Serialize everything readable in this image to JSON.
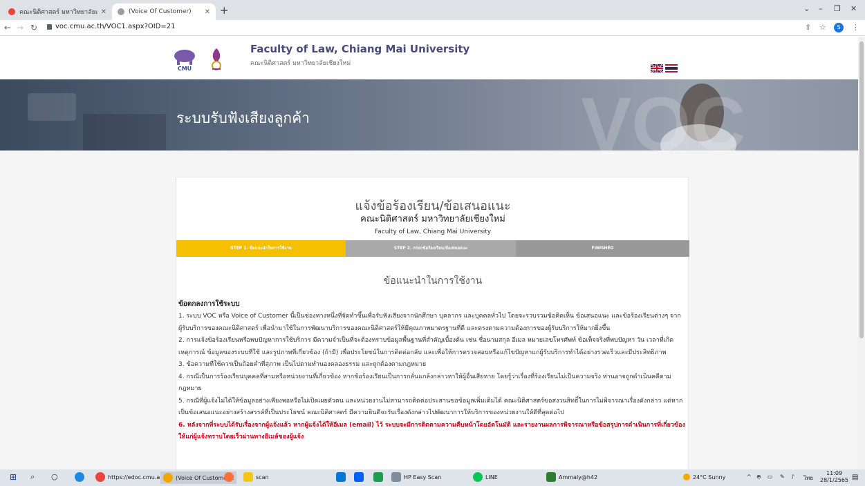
{
  "browser": {
    "tabs": [
      {
        "title": "คณะนิติศาสตร์ มหาวิทยาลัยเชียงใหม่ -"
      },
      {
        "title": "(Voice Of Customer)"
      }
    ],
    "url": "voc.cmu.ac.th/VOC1.aspx?OID=21",
    "profile_initial": "S"
  },
  "header": {
    "title": "Faculty of Law, Chiang Mai University",
    "subtitle": "คณะนิติศาสตร์ มหาวิทยาลัยเชียงใหม่",
    "logo_text": "CMU"
  },
  "banner": {
    "title": "ระบบรับฟังเสียงลูกค้า",
    "watermark": "VOC"
  },
  "form": {
    "title": "แจ้งข้อร้องเรียน/ข้อเสนอแนะ",
    "subtitle": "คณะนิติศาสตร์ มหาวิทยาลัยเชียงใหม่",
    "subtitle_en": "Faculty of Law, Chiang Mai University",
    "steps": [
      {
        "label": "STEP 1. ข้อแนะนำในการใช้งาน",
        "status": "active"
      },
      {
        "label": "STEP 2. กรอกข้อร้องเรียน/ข้อเสนอแนะ",
        "status": "inactive"
      },
      {
        "label": "FINISHED",
        "status": "inactive"
      }
    ],
    "section_title": "ข้อแนะนำในการใช้งาน",
    "terms_heading": "ข้อตกลงการใช้ระบบ",
    "terms": [
      "1. ระบบ VOC หรือ Voice of Customer นี้เป็นช่องทางหนึ่งที่จัดทำขึ้นเพื่อรับฟังเสียงจากนักศึกษา บุคลากร และบุคคลทั่วไป โดยจะรวบรวมข้อคิดเห็น ข้อเสนอแนะ และข้อร้องเรียนต่างๆ จากผู้รับบริการของคณะนิติศาสตร์ เพื่อนำมาใช้ในการพัฒนาบริการของคณะนิติศาสตร์ให้มีคุณภาพมาตรฐานที่ดี และตรงตามความต้องการของผู้รับบริการให้มากยิ่งขึ้น",
      "2. การแจ้งข้อร้องเรียนหรือพบปัญหาการใช้บริการ มีความจำเป็นที่จะต้องทราบข้อมูลพื้นฐานที่สำคัญเบื้องต้น เช่น ชื่อนามสกุล อีเมล หมายเลขโทรศัพท์ ข้อเท็จจริงที่พบปัญหา วัน เวลาที่เกิดเหตุการณ์ ข้อมูลของระบบที่ใช้ และรูปภาพที่เกี่ยวข้อง (ถ้ามี) เพื่อประโยชน์ในการติดต่อกลับ และเพื่อให้การตรวจสอบหรือแก้ไขปัญหาแก่ผู้รับบริการทำได้อย่างรวดเร็วและมีประสิทธิภาพ",
      "3. ข้อความที่ใช้ควรเป็นถ้อยคำที่สุภาพ เป็นไปตามทำนองคลองธรรม และถูกต้องตามกฎหมาย",
      "4. กรณีเป็นการร้องเรียนบุคคลที่สามหรือหน่วยงานที่เกี่ยวข้อง หากข้อร้องเรียนเป็นการกลั่นแกล้งกล่าวหาให้ผู้อื่นเสียหาย โดยรู้ว่าเรื่องที่ร้องเรียนไม่เป็นความจริง ท่านอาจถูกดำเนินคดีตามกฎหมาย",
      "5. กรณีที่ผู้แจ้งไม่ได้ให้ข้อมูลอย่างเพียงพอหรือไม่เปิดเผยตัวตน และหน่วยงานไม่สามารถติดต่อประสานขอข้อมูลเพิ่มเติมได้ คณะนิติศาสตร์ขอสงวนสิทธิ์ในการไม่พิจารณาเรื่องดังกล่าว แต่หากเป็นข้อเสนอแนะอย่างสร้างสรรค์ที่เป็นประโยชน์ คณะนิติศาสตร์ มีความยินดีจะรับเรื่องดังกล่าวไปพัฒนาการให้บริการของหน่วยงานให้ดีที่สุดต่อไป",
      "6. หลังจากที่ระบบได้รับเรื่องจากผู้แจ้งแล้ว หากผู้แจ้งได้ให้อีเมล (email) ไว้ ระบบจะมีการติดตามความคืบหน้าโดยอัตโนมัติ และรายงานผลการพิจารณาหรือข้อสรุปการดำเนินการที่เกี่ยวข้องให้แก่ผู้แจ้งทราบโดยเร็วผ่านทางอีเมล์ของผู้แจ้ง"
    ]
  },
  "taskbar": {
    "items": [
      {
        "label": "https://edoc.cmu.a..."
      },
      {
        "label": "(Voice Of Customer..."
      },
      {
        "label": "scan"
      },
      {
        "label": "HP Easy Scan"
      },
      {
        "label": "LINE"
      },
      {
        "label": "Ammaly@h42"
      }
    ],
    "weather": "24°C  Sunny",
    "language": "ไทย",
    "time": "11:09",
    "date": "28/1/2565"
  },
  "colors": {
    "step_active": "#f5c000",
    "step_inactive": "#a9a9a9",
    "warning_text": "#d0021b",
    "header_title": "#4a4a7a"
  }
}
